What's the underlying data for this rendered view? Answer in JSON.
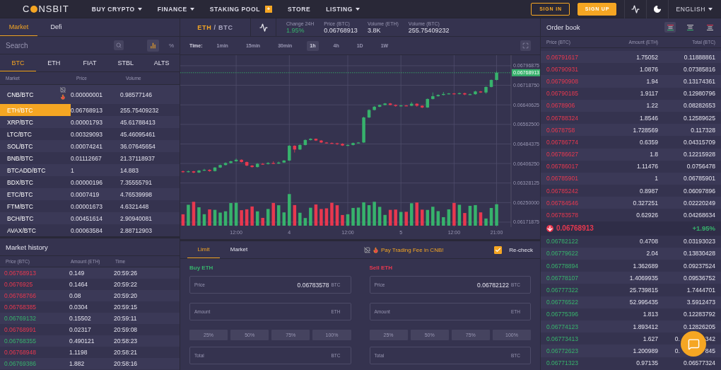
{
  "nav": {
    "logo_start": "C",
    "logo_end": "NSBIT",
    "items": [
      {
        "label": "BUY CRYPTO",
        "dropdown": true
      },
      {
        "label": "FINANCE",
        "dropdown": true
      },
      {
        "label": "STAKING POOL",
        "dropdown": false,
        "badge": "+"
      },
      {
        "label": "STORE",
        "dropdown": false
      },
      {
        "label": "LISTING",
        "dropdown": true
      }
    ],
    "actions": [
      {
        "label": "SIGN IN",
        "kind": "outline"
      },
      {
        "label": "SIGN UP",
        "kind": "filled"
      }
    ],
    "language": "ENGLISH"
  },
  "markets": {
    "tabs": [
      {
        "label": "Market",
        "selected": true
      },
      {
        "label": "Defi",
        "selected": false
      }
    ],
    "search": {
      "placeholder": "Search"
    },
    "percent_toggle": "%",
    "currencies": [
      {
        "label": "BTC",
        "selected": true
      },
      {
        "label": "ETH",
        "selected": false
      },
      {
        "label": "FIAT",
        "selected": false
      },
      {
        "label": "STBL",
        "selected": false
      },
      {
        "label": "ALTS",
        "selected": false
      }
    ],
    "columns": [
      "Market",
      "Price",
      "Volume"
    ],
    "rows": [
      {
        "market": "CNB/BTC",
        "price": "0.00000001",
        "volume": "0.98577146",
        "hot": true,
        "selected": false
      },
      {
        "market": "ETH/BTC",
        "price": "0.06768913",
        "volume": "255.75409232",
        "hot": false,
        "selected": true
      },
      {
        "market": "XRP/BTC",
        "price": "0.00001793",
        "volume": "45.61788413",
        "hot": false,
        "selected": false
      },
      {
        "market": "LTC/BTC",
        "price": "0.00329093",
        "volume": "45.46095461",
        "hot": false,
        "selected": false
      },
      {
        "market": "SOL/BTC",
        "price": "0.00074241",
        "volume": "36.07645654",
        "hot": false,
        "selected": false
      },
      {
        "market": "BNB/BTC",
        "price": "0.01112667",
        "volume": "21.37118937",
        "hot": false,
        "selected": false
      },
      {
        "market": "BTCADD/BTC",
        "price": "1",
        "volume": "14.883",
        "hot": false,
        "selected": false
      },
      {
        "market": "BDX/BTC",
        "price": "0.00000196",
        "volume": "7.35555791",
        "hot": false,
        "selected": false
      },
      {
        "market": "ETC/BTC",
        "price": "0.0007419",
        "volume": "4.76539998",
        "hot": false,
        "selected": false
      },
      {
        "market": "FTM/BTC",
        "price": "0.00001673",
        "volume": "4.6321448",
        "hot": false,
        "selected": false
      },
      {
        "market": "BCH/BTC",
        "price": "0.00451614",
        "volume": "2.90940081",
        "hot": false,
        "selected": false
      },
      {
        "market": "AVAX/BTC",
        "price": "0.00063584",
        "volume": "2.88712903",
        "hot": false,
        "selected": false
      }
    ]
  },
  "market_history": {
    "title": "Market history",
    "columns": [
      "Price (BTC)",
      "Amount (ETH)",
      "Time"
    ],
    "rows": [
      {
        "price": "0.06768913",
        "amount": "0.149",
        "time": "20:59:26",
        "buy": false
      },
      {
        "price": "0.0676925",
        "amount": "0.1464",
        "time": "20:59:22",
        "buy": false
      },
      {
        "price": "0.06768766",
        "amount": "0.08",
        "time": "20:59:20",
        "buy": false
      },
      {
        "price": "0.06768385",
        "amount": "0.0304",
        "time": "20:59:15",
        "buy": false
      },
      {
        "price": "0.06769132",
        "amount": "0.15502",
        "time": "20:59:11",
        "buy": true
      },
      {
        "price": "0.06768991",
        "amount": "0.02317",
        "time": "20:59:08",
        "buy": false
      },
      {
        "price": "0.06768355",
        "amount": "0.490121",
        "time": "20:58:23",
        "buy": true
      },
      {
        "price": "0.06768948",
        "amount": "1.1198",
        "time": "20:58:21",
        "buy": false
      },
      {
        "price": "0.06769386",
        "amount": "1.882",
        "time": "20:58:16",
        "buy": true
      }
    ]
  },
  "pair": {
    "base": "ETH",
    "separator": "/",
    "quote": "BTC",
    "stats": [
      {
        "label": "Change 24H",
        "value": "1.95%",
        "positive": true
      },
      {
        "label": "Price (BTC)",
        "value": "0.06768913",
        "positive": false
      },
      {
        "label": "Volume (ETH)",
        "value": "3.8K",
        "positive": false
      },
      {
        "label": "Volume (BTC)",
        "value": "255.75409232",
        "positive": false
      }
    ]
  },
  "timeframes": {
    "label": "Time:",
    "items": [
      {
        "label": "1min",
        "selected": false
      },
      {
        "label": "15min",
        "selected": false
      },
      {
        "label": "30min",
        "selected": false
      },
      {
        "label": "1h",
        "selected": true
      },
      {
        "label": "4h",
        "selected": false
      },
      {
        "label": "1D",
        "selected": false
      },
      {
        "label": "1W",
        "selected": false
      }
    ]
  },
  "chart": {
    "last_price": "0.06768913",
    "chart_data": {
      "type": "candlestick",
      "categories": [
        null,
        null,
        null,
        null,
        null,
        null,
        null,
        null,
        null,
        null,
        "12:00",
        null,
        null,
        null,
        null,
        null,
        null,
        null,
        null,
        null,
        "4",
        null,
        null,
        null,
        null,
        null,
        null,
        null,
        null,
        null,
        null,
        "12:00",
        null,
        null,
        null,
        null,
        null,
        null,
        null,
        null,
        null,
        "5",
        null,
        null,
        null,
        null,
        null,
        null,
        null,
        null,
        null,
        "12:00",
        null,
        null,
        null,
        null,
        null,
        null,
        null,
        "21:00"
      ],
      "ohlc": [
        [
          0.06375,
          0.06378,
          0.06369,
          0.06372
        ],
        [
          0.06372,
          0.06378,
          0.0637,
          0.06375
        ],
        [
          0.06375,
          0.06377,
          0.06367,
          0.0637
        ],
        [
          0.0637,
          0.0638,
          0.06368,
          0.06378
        ],
        [
          0.06378,
          0.06385,
          0.06376,
          0.06381
        ],
        [
          0.06381,
          0.06383,
          0.06373,
          0.06376
        ],
        [
          0.06376,
          0.06392,
          0.06374,
          0.0639
        ],
        [
          0.0639,
          0.06402,
          0.06388,
          0.064
        ],
        [
          0.064,
          0.06411,
          0.06398,
          0.06408
        ],
        [
          0.06408,
          0.06417,
          0.06406,
          0.06415
        ],
        [
          0.06415,
          0.06426,
          0.06413,
          0.06421
        ],
        [
          0.06421,
          0.06423,
          0.0641,
          0.06412
        ],
        [
          0.06412,
          0.06414,
          0.06395,
          0.06398
        ],
        [
          0.06398,
          0.064,
          0.06389,
          0.06392
        ],
        [
          0.06392,
          0.06408,
          0.0639,
          0.06405
        ],
        [
          0.06405,
          0.06408,
          0.06401,
          0.06404
        ],
        [
          0.06404,
          0.06412,
          0.06402,
          0.06408
        ],
        [
          0.06408,
          0.06415,
          0.06404,
          0.06406
        ],
        [
          0.06406,
          0.06414,
          0.06404,
          0.0641
        ],
        [
          0.0641,
          0.0642,
          0.06408,
          0.06418
        ],
        [
          0.06418,
          0.0648,
          0.06416,
          0.06477
        ],
        [
          0.06477,
          0.06479,
          0.0645,
          0.06462
        ],
        [
          0.06462,
          0.06484,
          0.0646,
          0.0648
        ],
        [
          0.0648,
          0.06503,
          0.06478,
          0.065
        ],
        [
          0.065,
          0.06507,
          0.06498,
          0.06505
        ],
        [
          0.06505,
          0.06506,
          0.06496,
          0.06498
        ],
        [
          0.06498,
          0.065,
          0.06488,
          0.0649
        ],
        [
          0.0649,
          0.06492,
          0.06486,
          0.06488
        ],
        [
          0.06488,
          0.0649,
          0.06485,
          0.06487
        ],
        [
          0.06487,
          0.06489,
          0.0648,
          0.06485
        ],
        [
          0.06485,
          0.06487,
          0.06476,
          0.06478
        ],
        [
          0.06478,
          0.06483,
          0.06476,
          0.0648
        ],
        [
          0.0648,
          0.0649,
          0.06478,
          0.06488
        ],
        [
          0.06488,
          0.06492,
          0.06486,
          0.0649
        ],
        [
          0.0649,
          0.06593,
          0.06488,
          0.0659
        ],
        [
          0.0659,
          0.06623,
          0.06588,
          0.0662
        ],
        [
          0.0662,
          0.06636,
          0.06618,
          0.06633
        ],
        [
          0.06633,
          0.06642,
          0.06631,
          0.0664
        ],
        [
          0.0664,
          0.06648,
          0.06638,
          0.06646
        ],
        [
          0.06646,
          0.06648,
          0.06638,
          0.0664
        ],
        [
          0.0664,
          0.06642,
          0.06633,
          0.06636
        ],
        [
          0.06636,
          0.06641,
          0.06634,
          0.06638
        ],
        [
          0.06638,
          0.0664,
          0.06635,
          0.06637
        ],
        [
          0.06637,
          0.06652,
          0.06635,
          0.06645
        ],
        [
          0.06645,
          0.06647,
          0.06633,
          0.06637
        ],
        [
          0.06637,
          0.06639,
          0.06627,
          0.0663
        ],
        [
          0.0663,
          0.06666,
          0.06628,
          0.06664
        ],
        [
          0.06664,
          0.0669,
          0.06662,
          0.06675
        ],
        [
          0.06675,
          0.06683,
          0.06673,
          0.0668
        ],
        [
          0.0668,
          0.06692,
          0.06678,
          0.06684
        ],
        [
          0.06684,
          0.06688,
          0.06682,
          0.06686
        ],
        [
          0.06686,
          0.06688,
          0.06682,
          0.06684
        ],
        [
          0.06684,
          0.0669,
          0.06682,
          0.06687
        ],
        [
          0.06687,
          0.06689,
          0.06679,
          0.06682
        ],
        [
          0.06682,
          0.06686,
          0.0668,
          0.06683
        ],
        [
          0.06683,
          0.06697,
          0.06681,
          0.06694
        ],
        [
          0.06694,
          0.06696,
          0.06688,
          0.0669
        ],
        [
          0.0669,
          0.06714,
          0.06685,
          0.06712
        ],
        [
          0.06712,
          0.06742,
          0.0671,
          0.0674
        ],
        [
          0.0674,
          0.06775,
          0.06738,
          0.06769
        ]
      ],
      "ylim": [
        0.06152,
        0.06839
      ],
      "grid": true,
      "ref_lines": [
        {
          "axis": "y",
          "value": 0.06768913
        }
      ],
      "yticks": [
        {
          "value": 0.06796875,
          "label": "0.06796875"
        },
        {
          "value": 0.0671875,
          "label": "0.06718750"
        },
        {
          "value": 0.06640625,
          "label": "0.06640625"
        },
        {
          "value": 0.065625,
          "label": "0.06562500"
        },
        {
          "value": 0.06484375,
          "label": "0.06484375"
        },
        {
          "value": 0.0640625,
          "label": "0.06406250"
        },
        {
          "value": 0.06328125,
          "label": "0.06328125"
        },
        {
          "value": 0.0625,
          "label": "0.06250000"
        },
        {
          "value": 0.06171875,
          "label": "0.06171875"
        }
      ]
    }
  },
  "order_form": {
    "tabs": [
      {
        "label": "Limit",
        "selected": true
      },
      {
        "label": "Market",
        "selected": false
      }
    ],
    "promo": "Pay Trading Fee in CNB!",
    "recheck": {
      "label": "Re-check",
      "checked": true
    },
    "sides": [
      {
        "title": "Buy ETH",
        "kind": "buy",
        "price_field": {
          "label": "Price",
          "value": "0.06783578",
          "unit": "BTC"
        },
        "amount_field": {
          "label": "Amount",
          "unit": "ETH"
        },
        "percents": [
          {
            "label": "25%",
            "disabled": true
          },
          {
            "label": "50%",
            "disabled": true
          },
          {
            "label": "75%",
            "disabled": true
          },
          {
            "label": "100%",
            "disabled": true
          }
        ],
        "total_field": {
          "label": "Total",
          "unit": "BTC"
        }
      },
      {
        "title": "Sell ETH",
        "kind": "sell",
        "price_field": {
          "label": "Price",
          "value": "0.06782122",
          "unit": "BTC"
        },
        "amount_field": {
          "label": "Amount",
          "unit": "ETH"
        },
        "percents": [
          {
            "label": "25%",
            "disabled": true
          },
          {
            "label": "50%",
            "disabled": true
          },
          {
            "label": "75%",
            "disabled": true
          },
          {
            "label": "100%",
            "disabled": true
          }
        ],
        "total_field": {
          "label": "Total",
          "unit": "BTC"
        }
      }
    ]
  },
  "order_book": {
    "title": "Order book",
    "views": [
      {
        "kind": "both",
        "selected": true
      },
      {
        "kind": "bids",
        "selected": false
      },
      {
        "kind": "asks",
        "selected": false
      }
    ],
    "columns": [
      "Price (BTC)",
      "Amount (ETH)",
      "Total (BTC)"
    ],
    "asks": [
      {
        "price": "0.06791617",
        "amount": "1.75052",
        "total": "0.11888861"
      },
      {
        "price": "0.06790931",
        "amount": "1.0876",
        "total": "0.07385816"
      },
      {
        "price": "0.06790908",
        "amount": "1.94",
        "total": "0.13174361"
      },
      {
        "price": "0.06790185",
        "amount": "1.9117",
        "total": "0.12980796"
      },
      {
        "price": "0.0678906",
        "amount": "1.22",
        "total": "0.08282653"
      },
      {
        "price": "0.06788324",
        "amount": "1.8546",
        "total": "0.12589625"
      },
      {
        "price": "0.0678758",
        "amount": "1.728569",
        "total": "0.117328"
      },
      {
        "price": "0.06786774",
        "amount": "0.6359",
        "total": "0.04315709"
      },
      {
        "price": "0.06786627",
        "amount": "1.8",
        "total": "0.12215928"
      },
      {
        "price": "0.06786017",
        "amount": "1.11476",
        "total": "0.0756478"
      },
      {
        "price": "0.06785901",
        "amount": "1",
        "total": "0.06785901"
      },
      {
        "price": "0.06785242",
        "amount": "0.8987",
        "total": "0.06097896"
      },
      {
        "price": "0.06784546",
        "amount": "0.327251",
        "total": "0.02220249"
      },
      {
        "price": "0.06783578",
        "amount": "0.62926",
        "total": "0.04268634"
      }
    ],
    "last": {
      "price": "0.06768913",
      "change": "+1.95%",
      "falling": true
    },
    "bids": [
      {
        "price": "0.06782122",
        "amount": "0.4708",
        "total": "0.03193023"
      },
      {
        "price": "0.06779622",
        "amount": "2.04",
        "total": "0.13830428"
      },
      {
        "price": "0.06778894",
        "amount": "1.362689",
        "total": "0.09237524"
      },
      {
        "price": "0.06778107",
        "amount": "1.4069935",
        "total": "0.09536752"
      },
      {
        "price": "0.06777322",
        "amount": "25.739815",
        "total": "1.7444701"
      },
      {
        "price": "0.06776522",
        "amount": "52.995435",
        "total": "3.5912473"
      },
      {
        "price": "0.06775396",
        "amount": "1.813",
        "total": "0.12283792"
      },
      {
        "price": "0.06774123",
        "amount": "1.893412",
        "total": "0.12826205"
      },
      {
        "price": "0.06773413",
        "amount": "1.627",
        "total_parts": [
          "0.",
          "342"
        ]
      },
      {
        "price": "0.06772623",
        "amount": "1.200989",
        "total_parts": [
          "0.",
          "845"
        ]
      },
      {
        "price": "0.06771323",
        "amount": "0.97135",
        "total": "0.06577324"
      }
    ]
  }
}
